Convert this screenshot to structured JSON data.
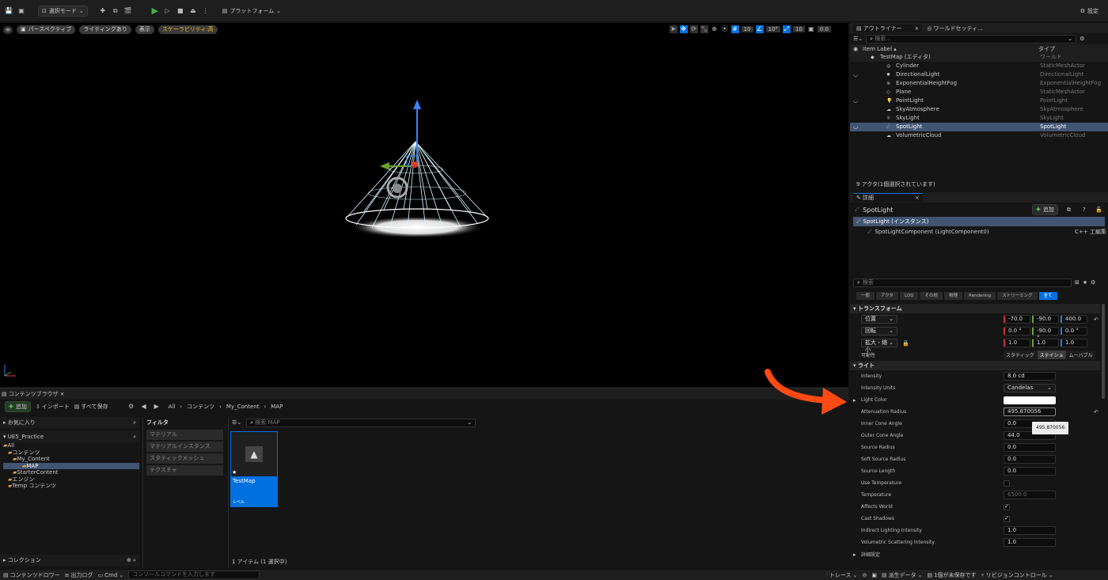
{
  "toolbar": {
    "mode": "選択モード",
    "platform": "プラットフォーム",
    "settings": "設定"
  },
  "viewport": {
    "perspective": "パースペクティブ",
    "lighting": "ライティングあり",
    "show": "表示",
    "scalability": "スケーラビリティ:高",
    "grid": "10",
    "angle": "10°",
    "scale": "10",
    "speed": "0.0"
  },
  "outliner": {
    "tab": "アウトライナー",
    "tab2": "ワールドセッティ...",
    "search": "検索...",
    "col_label": "Item Label ▴",
    "col_type": "タイプ",
    "items": [
      {
        "label": "TestMap (エディタ)",
        "type": "ワールド"
      },
      {
        "label": "Cylinder",
        "type": "StaticMeshActor"
      },
      {
        "label": "DirectionalLight",
        "type": "DirectionalLight"
      },
      {
        "label": "ExponentialHeightFog",
        "type": "ExponentialHeightFog"
      },
      {
        "label": "Plane",
        "type": "StaticMeshActor"
      },
      {
        "label": "PointLight",
        "type": "PointLight"
      },
      {
        "label": "SkyAtmosphere",
        "type": "SkyAtmosphere"
      },
      {
        "label": "SkyLight",
        "type": "SkyLight"
      },
      {
        "label": "SpotLight",
        "type": "SpotLight"
      },
      {
        "label": "VolumetricCloud",
        "type": "VolumetricCloud"
      }
    ],
    "status": "9 アクタ(1個選択されています)"
  },
  "details": {
    "tab": "詳細",
    "actor": "SpotLight",
    "add": "追加",
    "instance": "SpotLight (インスタンス)",
    "component": "SpotLightComponent (LightComponent0)",
    "cpp": "C++ 工編集",
    "search": "検索",
    "filters": [
      "一般",
      "アクタ",
      "LOD",
      "その他",
      "物理",
      "Rendering",
      "ストリーミング",
      "全て"
    ],
    "transform_section": "トランスフォーム",
    "location": {
      "label": "位置",
      "x": "-70.0",
      "y": "-90.0",
      "z": "400.0"
    },
    "rotation": {
      "label": "回転",
      "x": "0.0 °",
      "y": "-90.0 °",
      "z": "0.0 °"
    },
    "scale": {
      "label": "拡大・縮小",
      "x": "1.0",
      "y": "1.0",
      "z": "1.0"
    },
    "mobility": {
      "label": "可動性",
      "opts": [
        "スタティック",
        "ステイショ",
        "ムーバブル"
      ]
    },
    "light_section": "ライト",
    "intensity": {
      "label": "Intensity",
      "value": "8.0 cd"
    },
    "intensity_units": {
      "label": "Intensity Units",
      "value": "Candelas"
    },
    "light_color": {
      "label": "Light Color"
    },
    "attenuation": {
      "label": "Attenuation Radius",
      "value": "495.870056"
    },
    "inner_cone": {
      "label": "Inner Cone Angle",
      "value": "0.0"
    },
    "tooltip": "495.870056",
    "outer_cone": {
      "label": "Outer Cone Angle",
      "value": "44.0"
    },
    "source_radius": {
      "label": "Source Radius",
      "value": "0.0"
    },
    "soft_source": {
      "label": "Soft Source Radius",
      "value": "0.0"
    },
    "source_length": {
      "label": "Source Length",
      "value": "0.0"
    },
    "use_temp": {
      "label": "Use Temperature"
    },
    "temperature": {
      "label": "Temperature",
      "value": "6500.0"
    },
    "affects_world": {
      "label": "Affects World"
    },
    "cast_shadows": {
      "label": "Cast Shadows"
    },
    "indirect": {
      "label": "Indirect Lighting Intensity",
      "value": "1.0"
    },
    "volumetric": {
      "label": "Volumetric Scattering Intensity",
      "value": "1.0"
    },
    "advanced": "詳細設定"
  },
  "content_browser": {
    "tab": "コンテンツブラウザ",
    "add": "追加",
    "import": "インポート",
    "save_all": "すべて保存",
    "crumbs": [
      "All",
      "コンテンツ",
      "My_Content",
      "MAP"
    ],
    "favorites": "お気に入り",
    "project": "UE5_Practice",
    "tree": [
      "All",
      "コンテンツ",
      "My_Content",
      "MAP",
      "StarterContent",
      "エンジン",
      "Temp コンテンツ"
    ],
    "filters_title": "フィルタ",
    "filters": [
      "マテリアル",
      "マテリアルインスタンス",
      "スタティックメッシュ",
      "テクスチャ"
    ],
    "search": "検索 MAP",
    "asset_name": "TestMap",
    "asset_type": "レベル",
    "count": "1 アイテム (1 選択中)",
    "collections": "コレクション"
  },
  "statusbar": {
    "drawer": "コンテンツドロワー",
    "output": "出力ログ",
    "cmd": "Cmd",
    "console": "コンソールコマンドを入力します",
    "trace": "トレース",
    "derived": "派生データ",
    "unsaved": "1個が未保存です",
    "source": "リビジョンコントロール"
  },
  "colors": {
    "accent": "#0070e0",
    "selected": "#415472",
    "arrow": "#ff4a14"
  }
}
